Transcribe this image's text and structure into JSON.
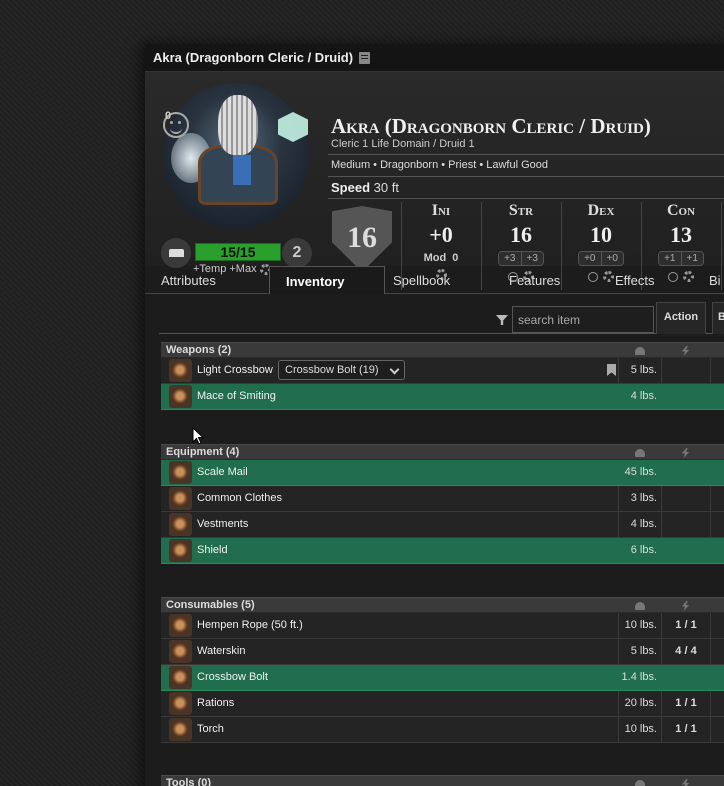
{
  "window": {
    "title": "Akra (Dragonborn Cleric / Druid)"
  },
  "character": {
    "name": "Akra (Dragonborn Cleric / Druid)",
    "class_line": "Cleric 1 Life Domain / Druid 1",
    "traits": "Medium • Dragonborn • Priest • Lawful Good",
    "speed_label": "Speed",
    "speed_value": "30 ft",
    "inspiration": "0",
    "hp": "15/15",
    "hit_dice": "2",
    "temp_max": "+Temp +Max",
    "ac": "16"
  },
  "stats": {
    "ini": {
      "label": "Ini",
      "value": "+0",
      "mod_label": "Mod",
      "mod_value": "0"
    },
    "str": {
      "label": "Str",
      "value": "16",
      "m1": "+3",
      "m2": "+3"
    },
    "dex": {
      "label": "Dex",
      "value": "10",
      "m1": "+0",
      "m2": "+0"
    },
    "con": {
      "label": "Con",
      "value": "13",
      "m1": "+1",
      "m2": "+1"
    }
  },
  "tabs": [
    "Attributes",
    "Inventory",
    "Spellbook",
    "Features",
    "Effects",
    "Bi"
  ],
  "toolbar": {
    "search_placeholder": "search item",
    "action_label": "Action",
    "b_label": "B"
  },
  "sections": {
    "weapons": {
      "title": "Weapons (2)",
      "items": [
        {
          "name": "Light Crossbow",
          "weight": "5 lbs.",
          "uses": "",
          "ammo": "Crossbow Bolt (19)"
        },
        {
          "name": "Mace of Smiting",
          "weight": "4 lbs.",
          "uses": ""
        }
      ]
    },
    "equipment": {
      "title": "Equipment (4)",
      "items": [
        {
          "name": "Scale Mail",
          "weight": "45 lbs.",
          "uses": ""
        },
        {
          "name": "Common Clothes",
          "weight": "3 lbs.",
          "uses": ""
        },
        {
          "name": "Vestments",
          "weight": "4 lbs.",
          "uses": ""
        },
        {
          "name": "Shield",
          "weight": "6 lbs.",
          "uses": ""
        }
      ]
    },
    "consumables": {
      "title": "Consumables (5)",
      "items": [
        {
          "name": "Hempen Rope (50 ft.)",
          "weight": "10 lbs.",
          "uses": "1 / 1"
        },
        {
          "name": "Waterskin",
          "weight": "5 lbs.",
          "uses": "4 / 4"
        },
        {
          "name": "Crossbow Bolt",
          "weight": "1.4 lbs.",
          "uses": ""
        },
        {
          "name": "Rations",
          "weight": "20 lbs.",
          "uses": "1 / 1"
        },
        {
          "name": "Torch",
          "weight": "10 lbs.",
          "uses": "1 / 1"
        }
      ]
    },
    "tools": {
      "title": "Tools (0)"
    }
  },
  "colors": {
    "equipped_row": "#206e4e",
    "hp_bar": "#29a02b"
  }
}
